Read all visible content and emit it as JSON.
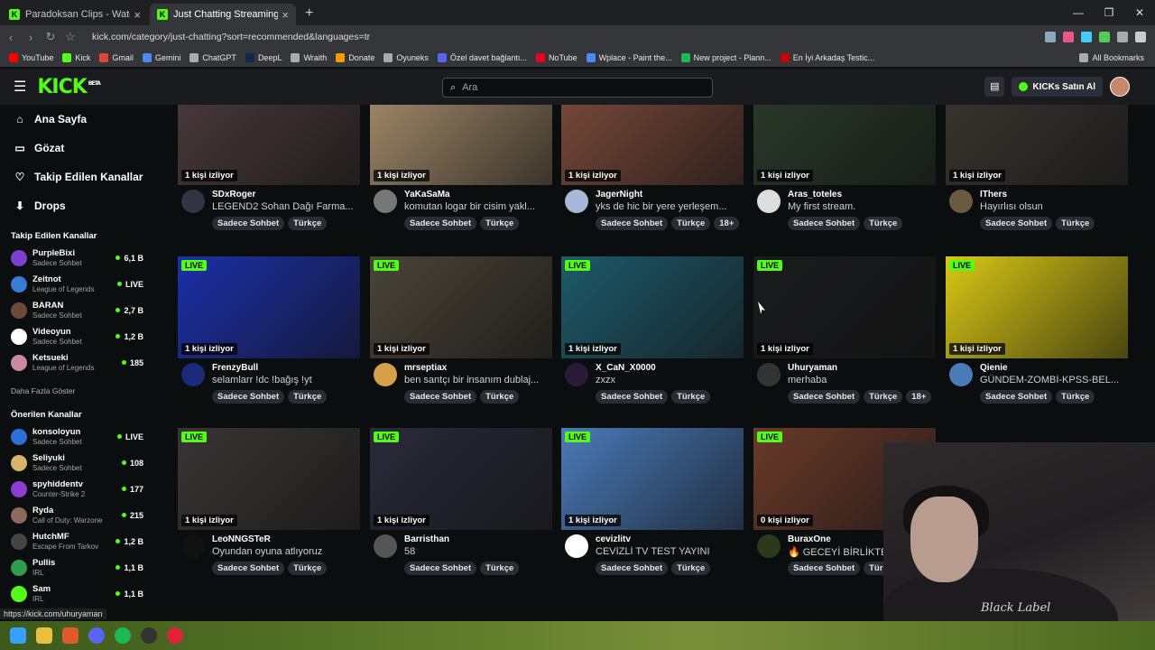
{
  "browser": {
    "tabs": [
      {
        "title": "Paradoksan Clips - Watch Live on Kick",
        "active": false
      },
      {
        "title": "Just Chatting Streaming - Live St",
        "active": true
      }
    ],
    "url": "kick.com/category/just-chatting?sort=recommended&languages=tr",
    "bookmarks": [
      "YouTube",
      "Kick",
      "Gmail",
      "Gemini",
      "ChatGPT",
      "DeepL",
      "Wraith",
      "Donate",
      "Oyuneks",
      "Özel davet bağlantı...",
      "NoTube",
      "Wplace - Paint the...",
      "New project - Plann...",
      "En İyi Arkadaş Testic..."
    ],
    "all_bookmarks": "All Bookmarks",
    "status_url": "https://kick.com/uhuryaman"
  },
  "header": {
    "logo": "KICK",
    "logo_sup": "BETA",
    "search_placeholder": "Ara",
    "buy_label": "KICKs Satın Al"
  },
  "sidebar": {
    "nav": [
      {
        "label": "Ana Sayfa",
        "icon": "home-icon",
        "glyph": "⌂"
      },
      {
        "label": "Gözat",
        "icon": "browse-icon",
        "glyph": "▭"
      },
      {
        "label": "Takip Edilen Kanallar",
        "icon": "heart-icon",
        "glyph": "♡"
      },
      {
        "label": "Drops",
        "icon": "drops-icon",
        "glyph": "⬇"
      }
    ],
    "followed_title": "Takip Edilen Kanallar",
    "followed": [
      {
        "name": "PurpleBixi",
        "category": "Sadece Sohbet",
        "viewers": "6,1 B",
        "color": "#7b3fd1"
      },
      {
        "name": "Zeitnot",
        "category": "League of Legends",
        "viewers": "LIVE",
        "color": "#3a7bd5"
      },
      {
        "name": "BARAN",
        "category": "Sadece Sohbet",
        "viewers": "2,7 B",
        "color": "#6b4a3a"
      },
      {
        "name": "Videoyun",
        "category": "Sadece Sohbet",
        "viewers": "1,2 B",
        "color": "#ffffff"
      },
      {
        "name": "Ketsueki",
        "category": "League of Legends",
        "viewers": "185",
        "color": "#c98aa0"
      }
    ],
    "show_more": "Daha Fazla Göster",
    "recommended_title": "Önerilen Kanallar",
    "recommended": [
      {
        "name": "konsoloyun",
        "category": "Sadece Sohbet",
        "viewers": "LIVE",
        "color": "#2d6fd6"
      },
      {
        "name": "Seliyuki",
        "category": "Sadece Sohbet",
        "viewers": "108",
        "color": "#d8b36a"
      },
      {
        "name": "spyhiddentv",
        "category": "Counter-Strike 2",
        "viewers": "177",
        "color": "#8a3fd1"
      },
      {
        "name": "Ryda",
        "category": "Call of Duty: Warzone",
        "viewers": "215",
        "color": "#8a6a5a"
      },
      {
        "name": "HutchMF",
        "category": "Escape From Tarkov",
        "viewers": "1,2 B",
        "color": "#444"
      },
      {
        "name": "Pullis",
        "category": "IRL",
        "viewers": "1,1 B",
        "color": "#2e9e4a"
      },
      {
        "name": "Sam",
        "category": "IRL",
        "viewers": "1,1 B",
        "color": "#53fc18"
      }
    ]
  },
  "streams": [
    {
      "user": "SDxRoger",
      "title": "LEGEND2 Sohan Dağı Farma...",
      "viewers": "1 kişi izliyor",
      "live": false,
      "tags": [
        "Sadece Sohbet",
        "Türkçe"
      ],
      "thumb": "#4a3a3a",
      "av": "#334"
    },
    {
      "user": "YaKaSaMa",
      "title": "komutan logar bir cisim yakl...",
      "viewers": "1 kişi izliyor",
      "live": false,
      "tags": [
        "Sadece Sohbet",
        "Türkçe"
      ],
      "thumb": "#a38b6b",
      "av": "#777"
    },
    {
      "user": "JagerNight",
      "title": "yks de hic bir yere yerleşem...",
      "viewers": "1 kişi izliyor",
      "live": false,
      "tags": [
        "Sadece Sohbet",
        "Türkçe",
        "18+"
      ],
      "thumb": "#7a4a3a",
      "av": "#a7b8d8"
    },
    {
      "user": "Aras_toteles",
      "title": "My first stream.",
      "viewers": "1 kişi izliyor",
      "live": false,
      "tags": [
        "Sadece Sohbet",
        "Türkçe"
      ],
      "thumb": "#2a3a2a",
      "av": "#ddd"
    },
    {
      "user": "IThers",
      "title": "Hayırlısı olsun",
      "viewers": "1 kişi izliyor",
      "live": false,
      "tags": [
        "Sadece Sohbet",
        "Türkçe"
      ],
      "thumb": "#3a3530",
      "av": "#6a5a40"
    },
    {
      "user": "FrenzyBull",
      "title": "selamlarr !dc !bağış !yt",
      "viewers": "1 kişi izliyor",
      "live": true,
      "tags": [
        "Sadece Sohbet",
        "Türkçe"
      ],
      "thumb": "#1c2fa8",
      "av": "#1b2a7a"
    },
    {
      "user": "mrseptiax",
      "title": "ben santçı bir insanım dublaj...",
      "viewers": "1 kişi izliyor",
      "live": true,
      "tags": [
        "Sadece Sohbet",
        "Türkçe"
      ],
      "thumb": "#4a4438",
      "av": "#d6a04a"
    },
    {
      "user": "X_CaN_X0000",
      "title": "zxzx",
      "viewers": "1 kişi izliyor",
      "live": true,
      "tags": [
        "Sadece Sohbet",
        "Türkçe"
      ],
      "thumb": "#1e5a6a",
      "av": "#2a1a3a"
    },
    {
      "user": "Uhuryaman",
      "title": "merhaba",
      "viewers": "1 kişi izliyor",
      "live": true,
      "tags": [
        "Sadece Sohbet",
        "Türkçe",
        "18+"
      ],
      "thumb": "#1a1b1d",
      "av": "#333"
    },
    {
      "user": "Qienie",
      "title": "GÜNDEM-ZOMBİ-KPSS-BEL...",
      "viewers": "1 kişi izliyor",
      "live": true,
      "tags": [
        "Sadece Sohbet",
        "Türkçe"
      ],
      "thumb": "#d8c814",
      "av": "#4a7ab8"
    },
    {
      "user": "LeoNNGSTeR",
      "title": "Oyundan oyuna atlıyoruz",
      "viewers": "1 kişi izliyor",
      "live": true,
      "tags": [
        "Sadece Sohbet",
        "Türkçe"
      ],
      "thumb": "#3a3535",
      "av": "#111"
    },
    {
      "user": "Barristhan",
      "title": "58",
      "viewers": "1 kişi izliyor",
      "live": true,
      "tags": [
        "Sadece Sohbet",
        "Türkçe"
      ],
      "thumb": "#2a2a3a",
      "av": "#555"
    },
    {
      "user": "cevizlitv",
      "title": "CEVİZLİ TV TEST YAYINI",
      "viewers": "1 kişi izliyor",
      "live": true,
      "tags": [
        "Sadece Sohbet",
        "Türkçe"
      ],
      "thumb": "#4a7ab8",
      "av": "#fff"
    },
    {
      "user": "BuraxOne",
      "title": "🔥 GECEYİ BİRLİKTE",
      "viewers": "0 kişi izliyor",
      "live": true,
      "tags": [
        "Sadece Sohbet",
        "Türkçe"
      ],
      "thumb": "#6a3a2a",
      "av": "#2a3a1a"
    }
  ],
  "webcam_shirt_text": "Black Label",
  "live_label": "LIVE"
}
